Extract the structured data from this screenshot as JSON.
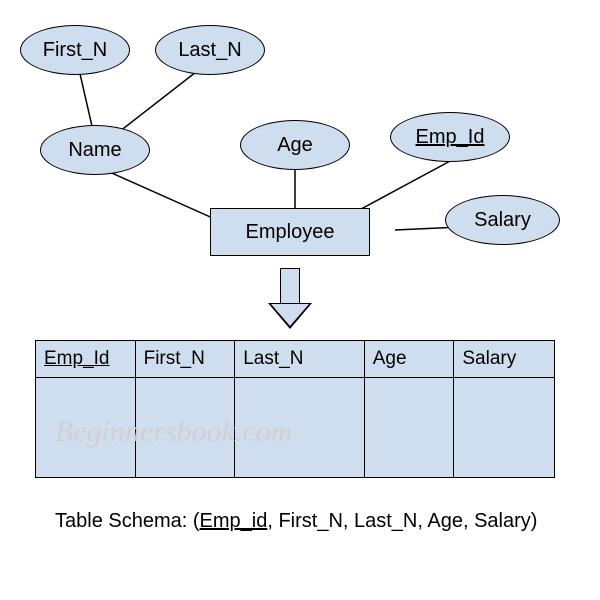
{
  "er": {
    "entity": "Employee",
    "attrs": {
      "first_n": "First_N",
      "last_n": "Last_N",
      "name": "Name",
      "age": "Age",
      "emp_id": "Emp_Id",
      "salary": "Salary"
    }
  },
  "table": {
    "columns": [
      "Emp_Id",
      "First_N",
      "Last_N",
      "Age",
      "Salary"
    ],
    "key_column_index": 0
  },
  "schema": {
    "prefix": "Table Schema: (",
    "key": "Emp_id",
    "rest": ", First_N, Last_N, Age, Salary)"
  },
  "watermark": "Beginnersbook.com"
}
